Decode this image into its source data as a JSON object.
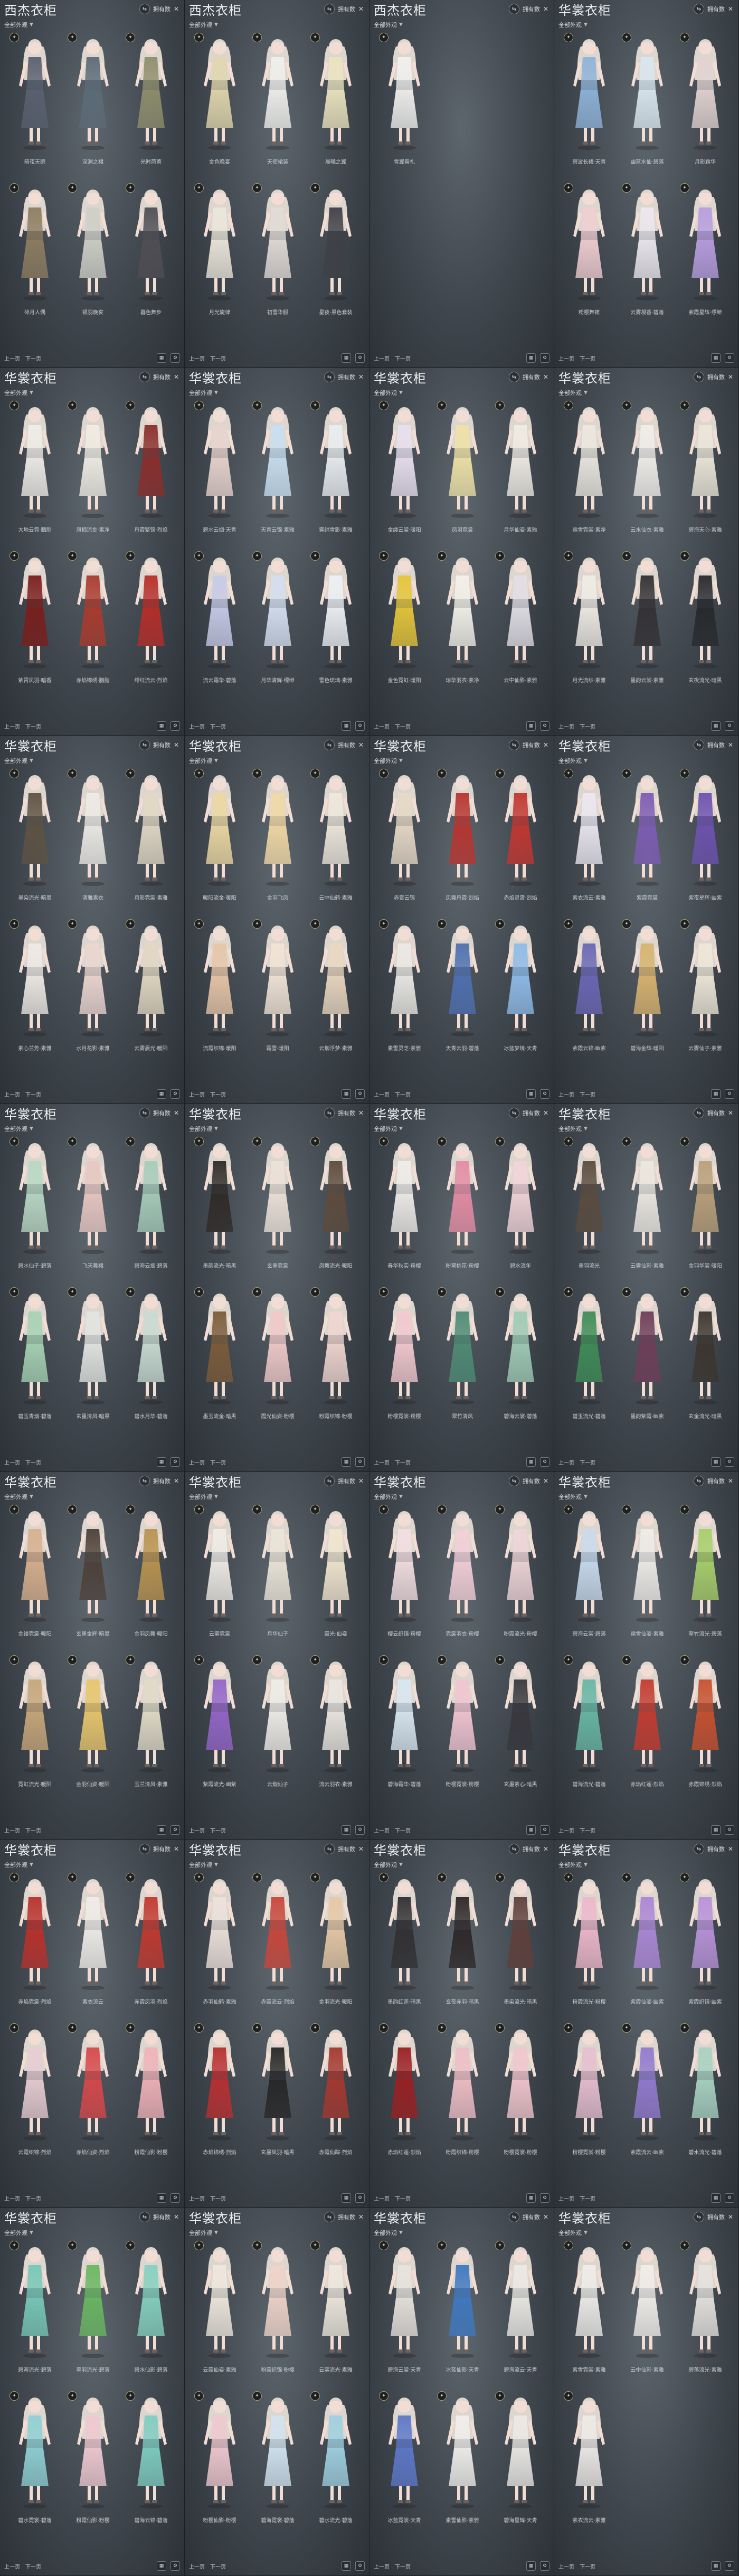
{
  "ui": {
    "filter_label": "全部外观",
    "top_status": "拥有数",
    "footer_prev": "上一页",
    "footer_next": "下一页",
    "badge_symbol": "✦",
    "row_capacity": 3
  },
  "panels": [
    {
      "title": "西杰衣柜",
      "row1_names": [
        "暗夜天鹅",
        "深渊之裙",
        "光时芭蕾"
      ],
      "row2_names": [
        "碎月人偶",
        "银羽晚宴",
        "暮色舞步"
      ],
      "colors": [
        "#59606f",
        "#5c6b77",
        "#8f8f6d",
        "#8d7d61",
        "#cfcfc7",
        "#4f4e54"
      ]
    },
    {
      "title": "西杰衣柜",
      "row1_names": [
        "金色晚宴",
        "天使裙装",
        "晨曦之翼"
      ],
      "row2_names": [
        "月光旋律",
        "初雪华服",
        "星夜·黑色套装"
      ],
      "colors": [
        "#e1d7ad",
        "#f0f0ec",
        "#ece4bf",
        "#ece7db",
        "#e2dbd6",
        "#3f4047"
      ]
    },
    {
      "title": "西杰衣柜",
      "row1_names": [
        "雪翼祭礼"
      ],
      "row2_names": [],
      "colors": [
        "#f2f1ef"
      ]
    },
    {
      "title": "华裳衣柜",
      "row1_names": [
        "碧波长裙·天青",
        "幽蓝水仙·碧落",
        "月影霜华"
      ],
      "row2_names": [
        "粉樱舞裙",
        "云雾凝香·碧落",
        "紫霞星辉·缥缈"
      ],
      "colors": [
        "#8fb3d9",
        "#d9e7ef",
        "#e2d3d1",
        "#f1ced2",
        "#ece8ee",
        "#b89ee0"
      ]
    },
    {
      "title": "华裳衣柜",
      "row1_names": [
        "大地云霓·胭脂",
        "凤栖流金·素净",
        "丹霞繁锦·烈焰"
      ],
      "row2_names": [
        "紫霄凤羽·暗香",
        "赤焰锦绣·胭脂",
        "绯红流云·烈焰"
      ],
      "colors": [
        "#f0ede8",
        "#f1ece4",
        "#8b2d2b",
        "#7b1d1c",
        "#aa3a2e",
        "#b72d28"
      ]
    },
    {
      "title": "华裳衣柜",
      "row1_names": [
        "碧水云烟·天青",
        "天青云锦·素雅",
        "雾绡雪影·素雅"
      ],
      "row2_names": [
        "流云霜华·碧落",
        "月华清辉·缥缈",
        "雪色琉璃·素雅"
      ],
      "colors": [
        "#e9d4ce",
        "#c8dff0",
        "#eaeef2",
        "#c7cbe8",
        "#d4dff0",
        "#eef1f5"
      ]
    },
    {
      "title": "华裳衣柜",
      "row1_names": [
        "金缕云裳·暖阳",
        "凤羽霓裳",
        "月华仙姿·素雅"
      ],
      "row2_names": [
        "金色霓虹·暖阳",
        "琼华羽衣·素净",
        "云中仙影·素雅"
      ],
      "colors": [
        "#e9e0ef",
        "#efe2a6",
        "#f0ece4",
        "#e6c638",
        "#f3f1e9",
        "#e2dfe6"
      ]
    },
    {
      "title": "华裳衣柜",
      "row1_names": [
        "霜雪霓裳·素净",
        "云水仙衣·素雅",
        "碧海天心·素雅"
      ],
      "row2_names": [
        "月光流纱·素雅",
        "墨韵云裳·素雅",
        "玄夜流光·暗黑"
      ],
      "colors": [
        "#ece8e0",
        "#f1eeea",
        "#ece7d9",
        "#f0ece6",
        "#333033",
        "#27292c"
      ]
    },
    {
      "title": "华裳衣柜",
      "row1_names": [
        "墨染流光·暗黑",
        "清雅素衣",
        "月影霓裳·素雅"
      ],
      "row2_names": [
        "素心兰芳·素雅",
        "水月花影·素雅",
        "云雾晨光·暖阳"
      ],
      "colors": [
        "#5e5243",
        "#eeebe6",
        "#e2d8c5",
        "#efeae5",
        "#ecd6d0",
        "#e3d7c2"
      ]
    },
    {
      "title": "华裳衣柜",
      "row1_names": [
        "暖阳流金·暖阳",
        "金羽飞凤",
        "云中仙鹤·素雅"
      ],
      "row2_names": [
        "流霞织锦·暖阳",
        "霜雪·暖阳",
        "云烟浮梦·素雅"
      ],
      "colors": [
        "#ecd8a2",
        "#f2d9a4",
        "#efe8dc",
        "#e8c6a8",
        "#f2e4d6",
        "#ead7c0"
      ]
    },
    {
      "title": "华裳衣柜",
      "row1_names": [
        "赤霄云锦",
        "凤舞丹霞·烈焰",
        "赤焰灵霄·烈焰"
      ],
      "row2_names": [
        "素雪灵芝·素雅",
        "天青云羽·碧落",
        "冰蓝梦境·天青"
      ],
      "colors": [
        "#e7d9c7",
        "#b9342f",
        "#c23630",
        "#eceae5",
        "#4e6fb0",
        "#8fbbe8"
      ]
    },
    {
      "title": "华裳衣柜",
      "row1_names": [
        "素衣流云·素雅",
        "紫霞霓裳",
        "紫夜星辉·幽紫"
      ],
      "row2_names": [
        "紫霞云锦·幽紫",
        "碧海金辉·暖阳",
        "云雾仙子·素雅"
      ],
      "colors": [
        "#ece7f2",
        "#7d5bb5",
        "#6d52b0",
        "#6a67b6",
        "#d8b36e",
        "#efe8d9"
      ]
    },
    {
      "title": "华裳衣柜",
      "row1_names": [
        "碧水仙子·碧落",
        "飞天舞裙",
        "碧海云烟·碧落"
      ],
      "row2_names": [
        "碧玉青烟·碧落",
        "玄墨清风·暗黑",
        "碧水月华·碧落"
      ],
      "colors": [
        "#b9d8c4",
        "#e8c7c2",
        "#a7cdbb",
        "#a6d2b4",
        "#e3e5e2",
        "#c9dbd3"
      ]
    },
    {
      "title": "华裳衣柜",
      "row1_names": [
        "墨韵流光·暗黑",
        "玄墨霓裳",
        "凤舞流光·暖阳"
      ],
      "row2_names": [
        "墨玉流金·暗黑",
        "霞光仙姿·粉樱",
        "粉霞织锦·粉樱"
      ],
      "colors": [
        "#2f2a27",
        "#ede2d8",
        "#5d4b3c",
        "#7c5b3a",
        "#f0c9c8",
        "#f1d6d0"
      ]
    },
    {
      "title": "华裳衣柜",
      "row1_names": [
        "春华秋实·粉樱",
        "粉黛桃花·粉樱",
        "碧水流年"
      ],
      "row2_names": [
        "粉樱霓裳·粉樱",
        "翠竹清风",
        "碧海云裳·碧落"
      ],
      "colors": [
        "#f0ede9",
        "#e58ca4",
        "#f2d4d9",
        "#f3c9cf",
        "#4e8b74",
        "#9fcbb5"
      ]
    },
    {
      "title": "华裳衣柜",
      "row1_names": [
        "墨羽流光",
        "云雾仙影·素雅",
        "金羽华裳·暖阳"
      ],
      "row2_names": [
        "碧玉流光·碧落",
        "墨韵紫霞·幽紫",
        "玄金流光·暗黑"
      ],
      "colors": [
        "#5a4b3e",
        "#ece8e0",
        "#bba07a",
        "#3f8c57",
        "#6e3d58",
        "#3b352f"
      ]
    },
    {
      "title": "华裳衣柜",
      "row1_names": [
        "金缕霓裳·暖阳",
        "玄墨金辉·暗黑",
        "金羽凤舞·暖阳"
      ],
      "row2_names": [
        "霓虹流光·暖阳",
        "金羽仙姿·暖阳",
        "玉兰清风·素雅"
      ],
      "colors": [
        "#d8b08f",
        "#4c4038",
        "#b9934f",
        "#c7a77a",
        "#e8c66b",
        "#e2dbc8"
      ]
    },
    {
      "title": "华裳衣柜",
      "row1_names": [
        "云雾霓裳",
        "月华仙子",
        "霞光·仙姿"
      ],
      "row2_names": [
        "紫霞流光·幽紫",
        "云烟仙子",
        "流云羽衣·素雅"
      ],
      "colors": [
        "#f0ece6",
        "#ece5d8",
        "#f2e6cf",
        "#9465c8",
        "#f0ede8",
        "#ebe7e0"
      ]
    },
    {
      "title": "华裳衣柜",
      "row1_names": [
        "樱云织锦·粉樱",
        "霓裳羽衣·粉樱",
        "粉霞流光·粉樱"
      ],
      "row2_names": [
        "碧海霜华·碧落",
        "粉樱霓裳·粉樱",
        "玄墨素心·暗黑"
      ],
      "colors": [
        "#f3dfe2",
        "#f3cfd7",
        "#efd5d9",
        "#d9e7f1",
        "#f1c5d1",
        "#37373d"
      ]
    },
    {
      "title": "华裳衣柜",
      "row1_names": [
        "碧海云裳·碧落",
        "霜雪仙姿·素雅",
        "翠竹流光·碧落"
      ],
      "row2_names": [
        "碧海流光·碧落",
        "赤焰红莲·烈焰",
        "赤霞锦绣·烈焰"
      ],
      "colors": [
        "#c9dbee",
        "#efece8",
        "#a8cf6a",
        "#68b7a5",
        "#c43a2f",
        "#c8502f"
      ]
    },
    {
      "title": "华裳衣柜",
      "row1_names": [
        "赤焰霓裳·烈焰",
        "素衣流云",
        "赤霞凤羽·烈焰"
      ],
      "row2_names": [
        "云霞织锦·烈焰",
        "赤焰仙姿·烈焰",
        "粉霞仙影·粉樱"
      ],
      "colors": [
        "#b9302b",
        "#f0ede8",
        "#c2382f",
        "#e7cdd3",
        "#d7474a",
        "#f0b3b9"
      ]
    },
    {
      "title": "华裳衣柜",
      "row1_names": [
        "赤羽仙鹤·素雅",
        "赤霞流云·烈焰",
        "金羽流光·暖阳"
      ],
      "row2_names": [
        "赤焰锦绣·烈焰",
        "玄墨凤羽·暗黑",
        "赤霞仙踪·烈焰"
      ],
      "colors": [
        "#ede2dc",
        "#c9463a",
        "#e6c9a6",
        "#b92f31",
        "#262627",
        "#a5382f"
      ]
    },
    {
      "title": "华裳衣柜",
      "row1_names": [
        "墨韵红莲·暗黑",
        "玄夜赤羽·暗黑",
        "墨染流光·暗黑"
      ],
      "row2_names": [
        "赤焰红莲·烈焰",
        "粉霞织锦·粉樱",
        "粉樱霓裳·粉樱"
      ],
      "colors": [
        "#313032",
        "#2c2627",
        "#5f3f3b",
        "#9a1f22",
        "#efbfc5",
        "#f2c6cd"
      ]
    },
    {
      "title": "华裳衣柜",
      "row1_names": [
        "粉霞流光·粉樱",
        "紫霞仙姿·幽紫",
        "紫霞织锦·幽紫"
      ],
      "row2_names": [
        "粉樱霓裳·粉樱",
        "紫霞流云·幽紫",
        "碧水流光·碧落"
      ],
      "colors": [
        "#eeb8cb",
        "#ab86d6",
        "#b892d9",
        "#e7bfd0",
        "#9279cf",
        "#a8d2c1"
      ]
    },
    {
      "title": "华裳衣柜",
      "row1_names": [
        "碧海流光·碧落",
        "翠羽流光·碧落",
        "碧水仙影·碧落"
      ],
      "row2_names": [
        "碧水霓裳·碧落",
        "粉霞仙影·粉樱",
        "碧海云锦·碧落"
      ],
      "colors": [
        "#77c8b8",
        "#69b760",
        "#85d1c0",
        "#8fd0d4",
        "#efc9d0",
        "#7fcdc2"
      ]
    },
    {
      "title": "华裳衣柜",
      "row1_names": [
        "云霞仙姿·素雅",
        "粉霞织锦·粉樱",
        "云雾流光·素雅"
      ],
      "row2_names": [
        "粉樱仙影·粉樱",
        "碧海霓裳·碧落",
        "碧水流光·碧落"
      ],
      "colors": [
        "#efe8de",
        "#efd3c9",
        "#eee8dd",
        "#f0c8cf",
        "#d1e4f0",
        "#9fd0e1"
      ]
    },
    {
      "title": "华裳衣柜",
      "row1_names": [
        "碧海云裳·天青",
        "冰蓝仙影·天青",
        "碧海流云·天青"
      ],
      "row2_names": [
        "冰蓝霓裳·天青",
        "素雪仙影·素雅",
        "碧海星辉·天青"
      ],
      "colors": [
        "#e8e3dd",
        "#3e78c1",
        "#eceae6",
        "#5d78c9",
        "#f1efec",
        "#eceae6"
      ]
    },
    {
      "title": "华裳衣柜",
      "row1_names": [
        "素雪霓裳·素雅",
        "云中仙影·素雅",
        "碧落流光·素雅"
      ],
      "row2_names": [
        "素衣流云·素雅"
      ],
      "colors": [
        "#efede9",
        "#f1eeea",
        "#e6e3df",
        "#eeebe7"
      ]
    }
  ]
}
